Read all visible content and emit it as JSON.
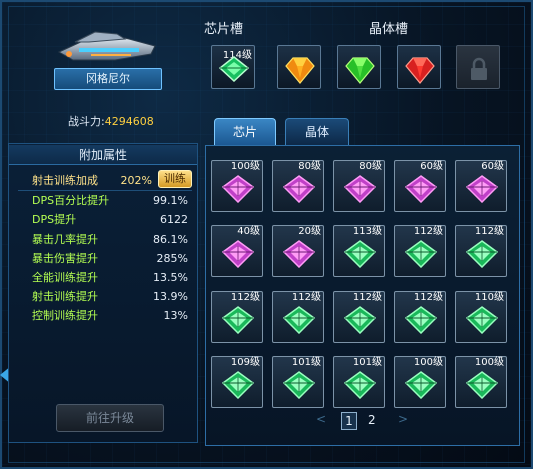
{
  "ship": {
    "name": "冈格尼尔"
  },
  "power": {
    "label": "战斗力:",
    "value": "4294608"
  },
  "attributes": {
    "title": "附加属性",
    "train_button": "训练",
    "upgrade_button": "前往升级",
    "rows": [
      {
        "name": "射击训练加成",
        "value": "202%"
      },
      {
        "name": "DPS百分比提升",
        "value": "99.1%"
      },
      {
        "name": "DPS提升",
        "value": "6122"
      },
      {
        "name": "暴击几率提升",
        "value": "86.1%"
      },
      {
        "name": "暴击伤害提升",
        "value": "285%"
      },
      {
        "name": "全能训练提升",
        "value": "13.5%"
      },
      {
        "name": "射击训练提升",
        "value": "13.9%"
      },
      {
        "name": "控制训练提升",
        "value": "13%"
      }
    ]
  },
  "chip_slot": {
    "title": "芯片槽",
    "level": "114级",
    "gem": "green"
  },
  "crystal_slot": {
    "title": "晶体槽",
    "slots": [
      {
        "gem": "orange"
      },
      {
        "gem": "green"
      },
      {
        "gem": "red"
      },
      {
        "gem": "lock-icon"
      }
    ]
  },
  "tabs": [
    {
      "label": "芯片",
      "active": true
    },
    {
      "label": "晶体",
      "active": false
    }
  ],
  "inventory": [
    {
      "level": "100级",
      "color": "purple"
    },
    {
      "level": "80级",
      "color": "purple"
    },
    {
      "level": "80级",
      "color": "purple"
    },
    {
      "level": "60级",
      "color": "purple"
    },
    {
      "level": "60级",
      "color": "purple"
    },
    {
      "level": "40级",
      "color": "purple"
    },
    {
      "level": "20级",
      "color": "purple"
    },
    {
      "level": "113级",
      "color": "green"
    },
    {
      "level": "112级",
      "color": "green"
    },
    {
      "level": "112级",
      "color": "green"
    },
    {
      "level": "112级",
      "color": "green"
    },
    {
      "level": "112级",
      "color": "green"
    },
    {
      "level": "112级",
      "color": "green"
    },
    {
      "level": "112级",
      "color": "green"
    },
    {
      "level": "110级",
      "color": "green"
    },
    {
      "level": "109级",
      "color": "green"
    },
    {
      "level": "101级",
      "color": "green"
    },
    {
      "level": "101级",
      "color": "green"
    },
    {
      "level": "100级",
      "color": "green"
    },
    {
      "level": "100级",
      "color": "green"
    }
  ],
  "pager": {
    "prev": "<",
    "pages": [
      "1",
      "2"
    ],
    "current": "1",
    "next": ">"
  }
}
